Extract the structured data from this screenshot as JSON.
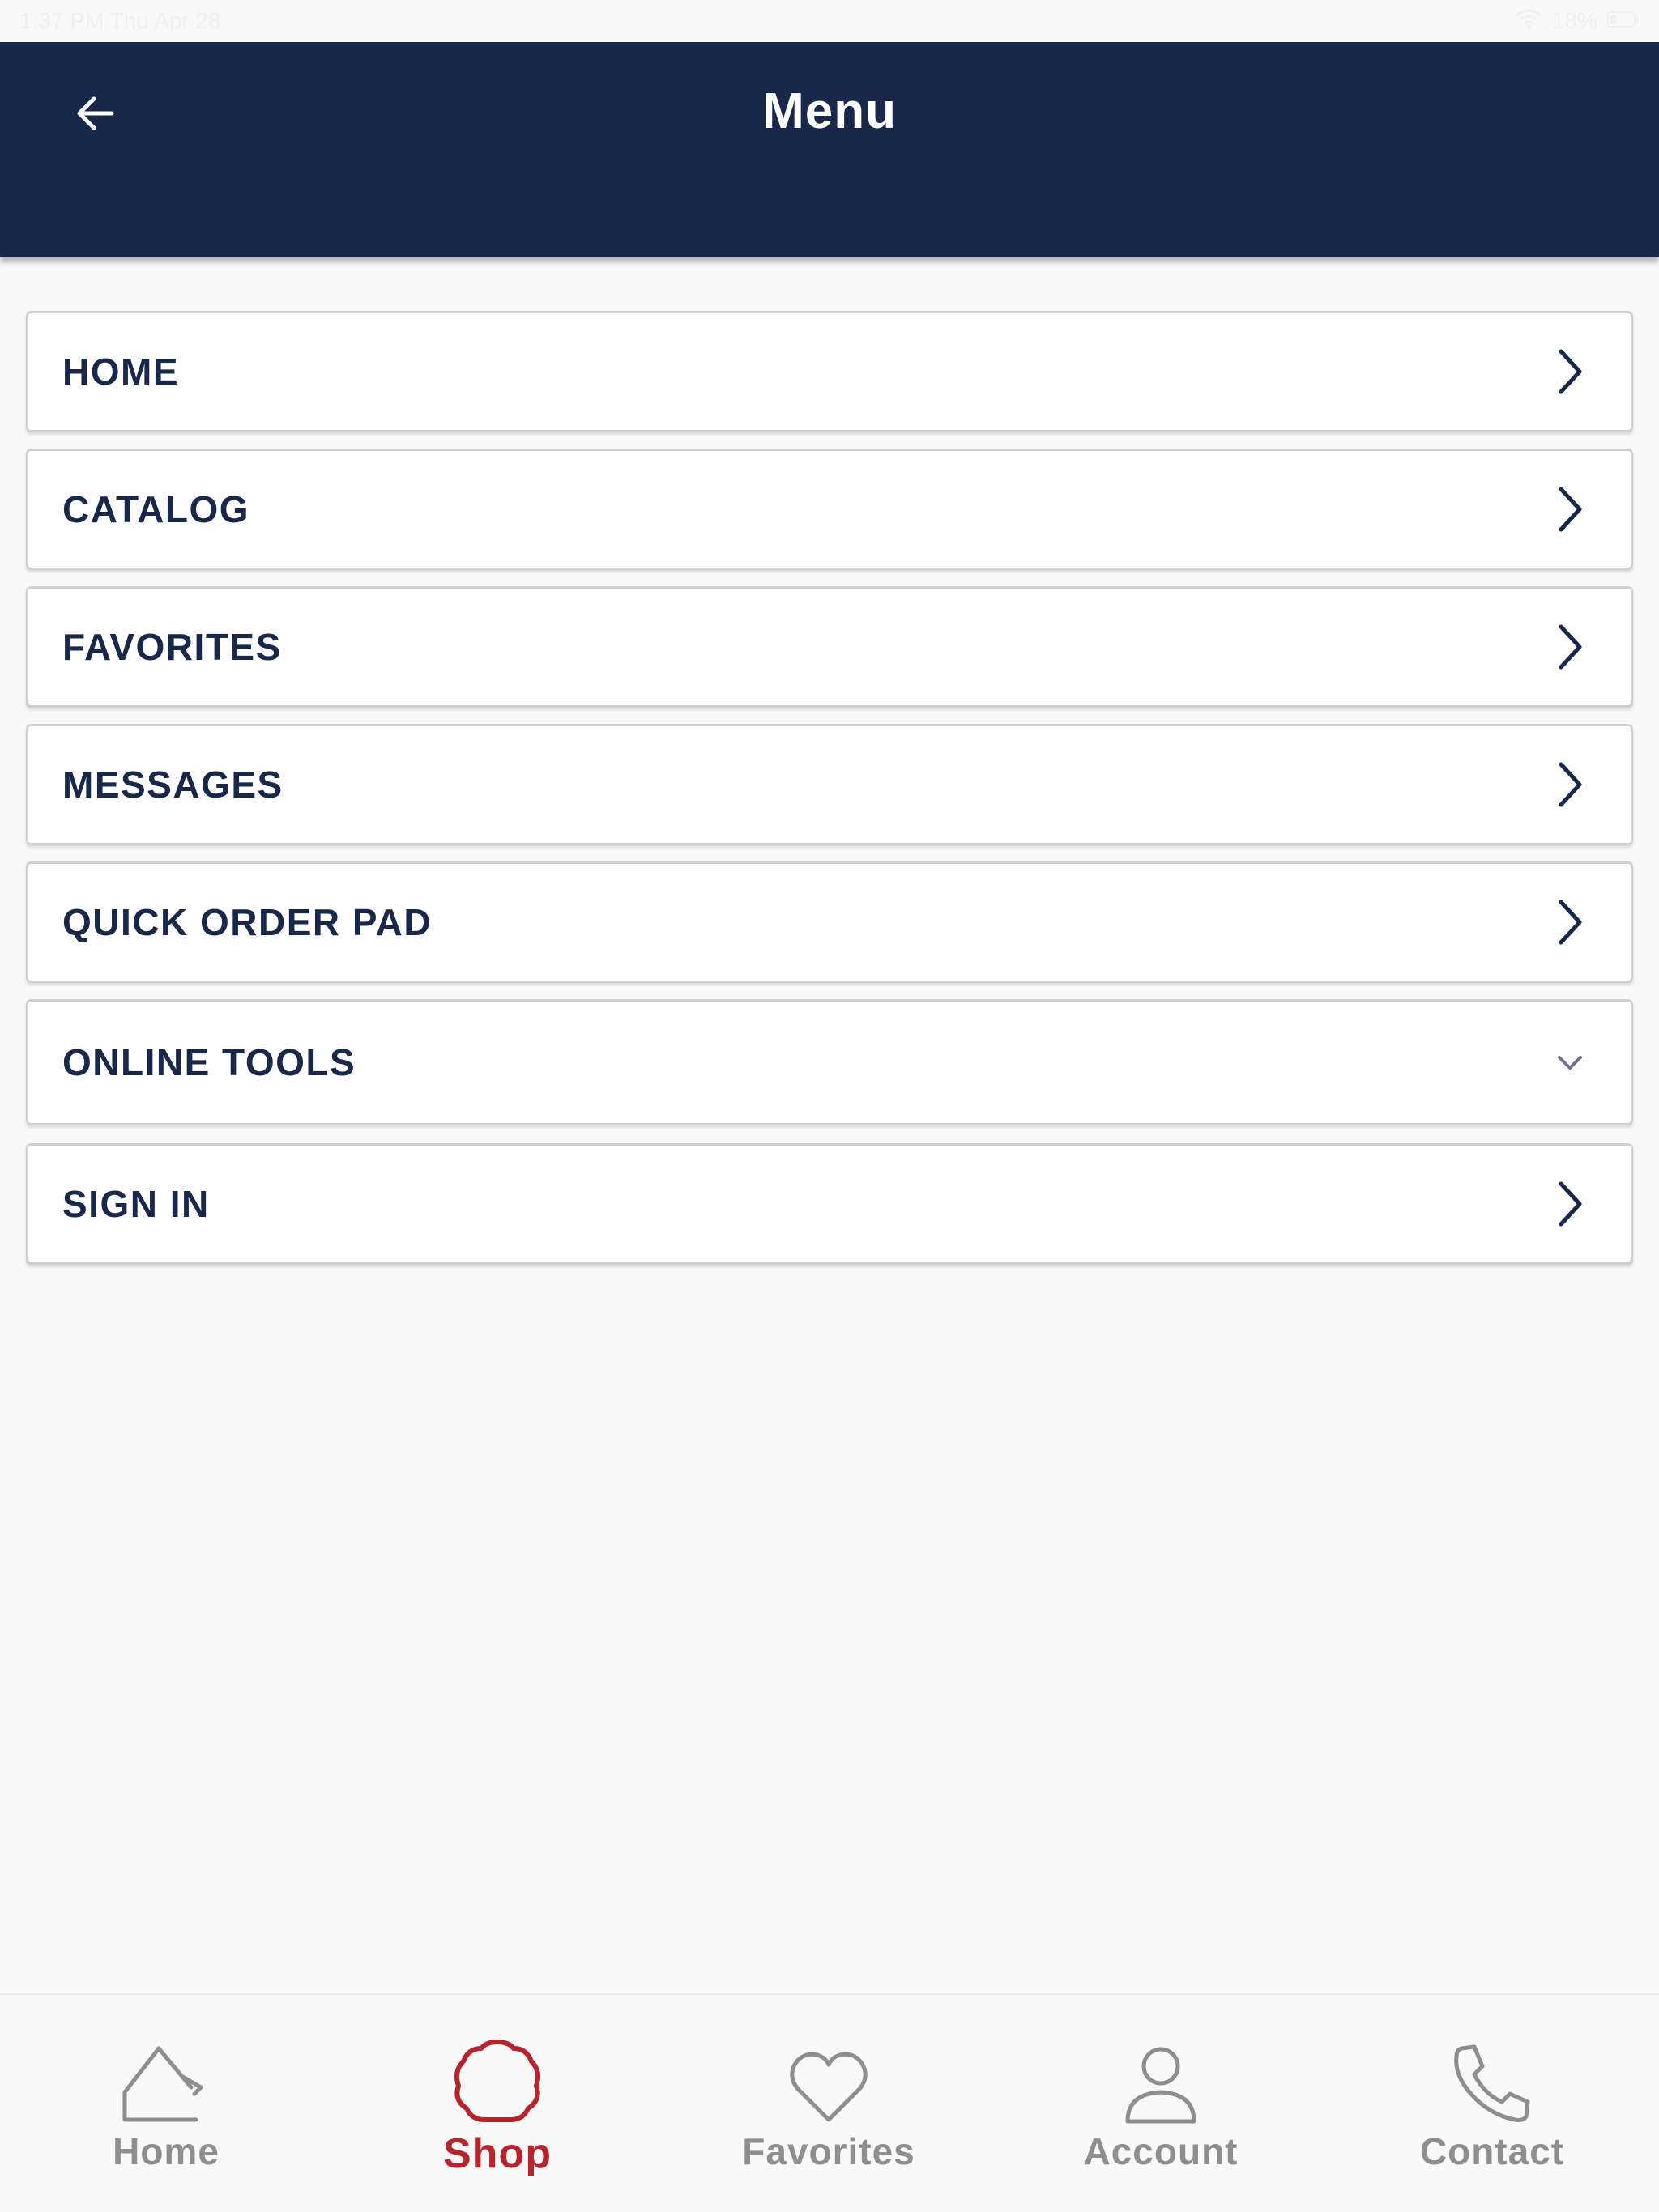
{
  "status_bar": {
    "time_date": "1:37 PM  Thu Apr 28",
    "battery": "18%"
  },
  "header": {
    "title": "Menu",
    "back_icon": "arrow-left-icon"
  },
  "menu": {
    "items": [
      {
        "label": "HOME",
        "icon": "chevron-right-icon"
      },
      {
        "label": "CATALOG",
        "icon": "chevron-right-icon"
      },
      {
        "label": "FAVORITES",
        "icon": "chevron-right-icon"
      },
      {
        "label": "MESSAGES",
        "icon": "chevron-right-icon"
      },
      {
        "label": "QUICK ORDER PAD",
        "icon": "chevron-right-icon"
      },
      {
        "label": "ONLINE TOOLS",
        "icon": "chevron-down-icon"
      },
      {
        "label": "SIGN IN",
        "icon": "chevron-right-icon"
      }
    ]
  },
  "tab_bar": {
    "tabs": [
      {
        "label": "Home",
        "icon": "home-icon",
        "active": false
      },
      {
        "label": "Shop",
        "icon": "shop-icon",
        "active": true
      },
      {
        "label": "Favorites",
        "icon": "heart-icon",
        "active": false
      },
      {
        "label": "Account",
        "icon": "person-icon",
        "active": false
      },
      {
        "label": "Contact",
        "icon": "phone-icon",
        "active": false
      }
    ]
  },
  "colors": {
    "header_bg": "#17284a",
    "menu_text": "#17284a",
    "active_tab": "#b8242c",
    "inactive_tab": "#8e8e8e",
    "page_bg": "#f9f9f9"
  }
}
